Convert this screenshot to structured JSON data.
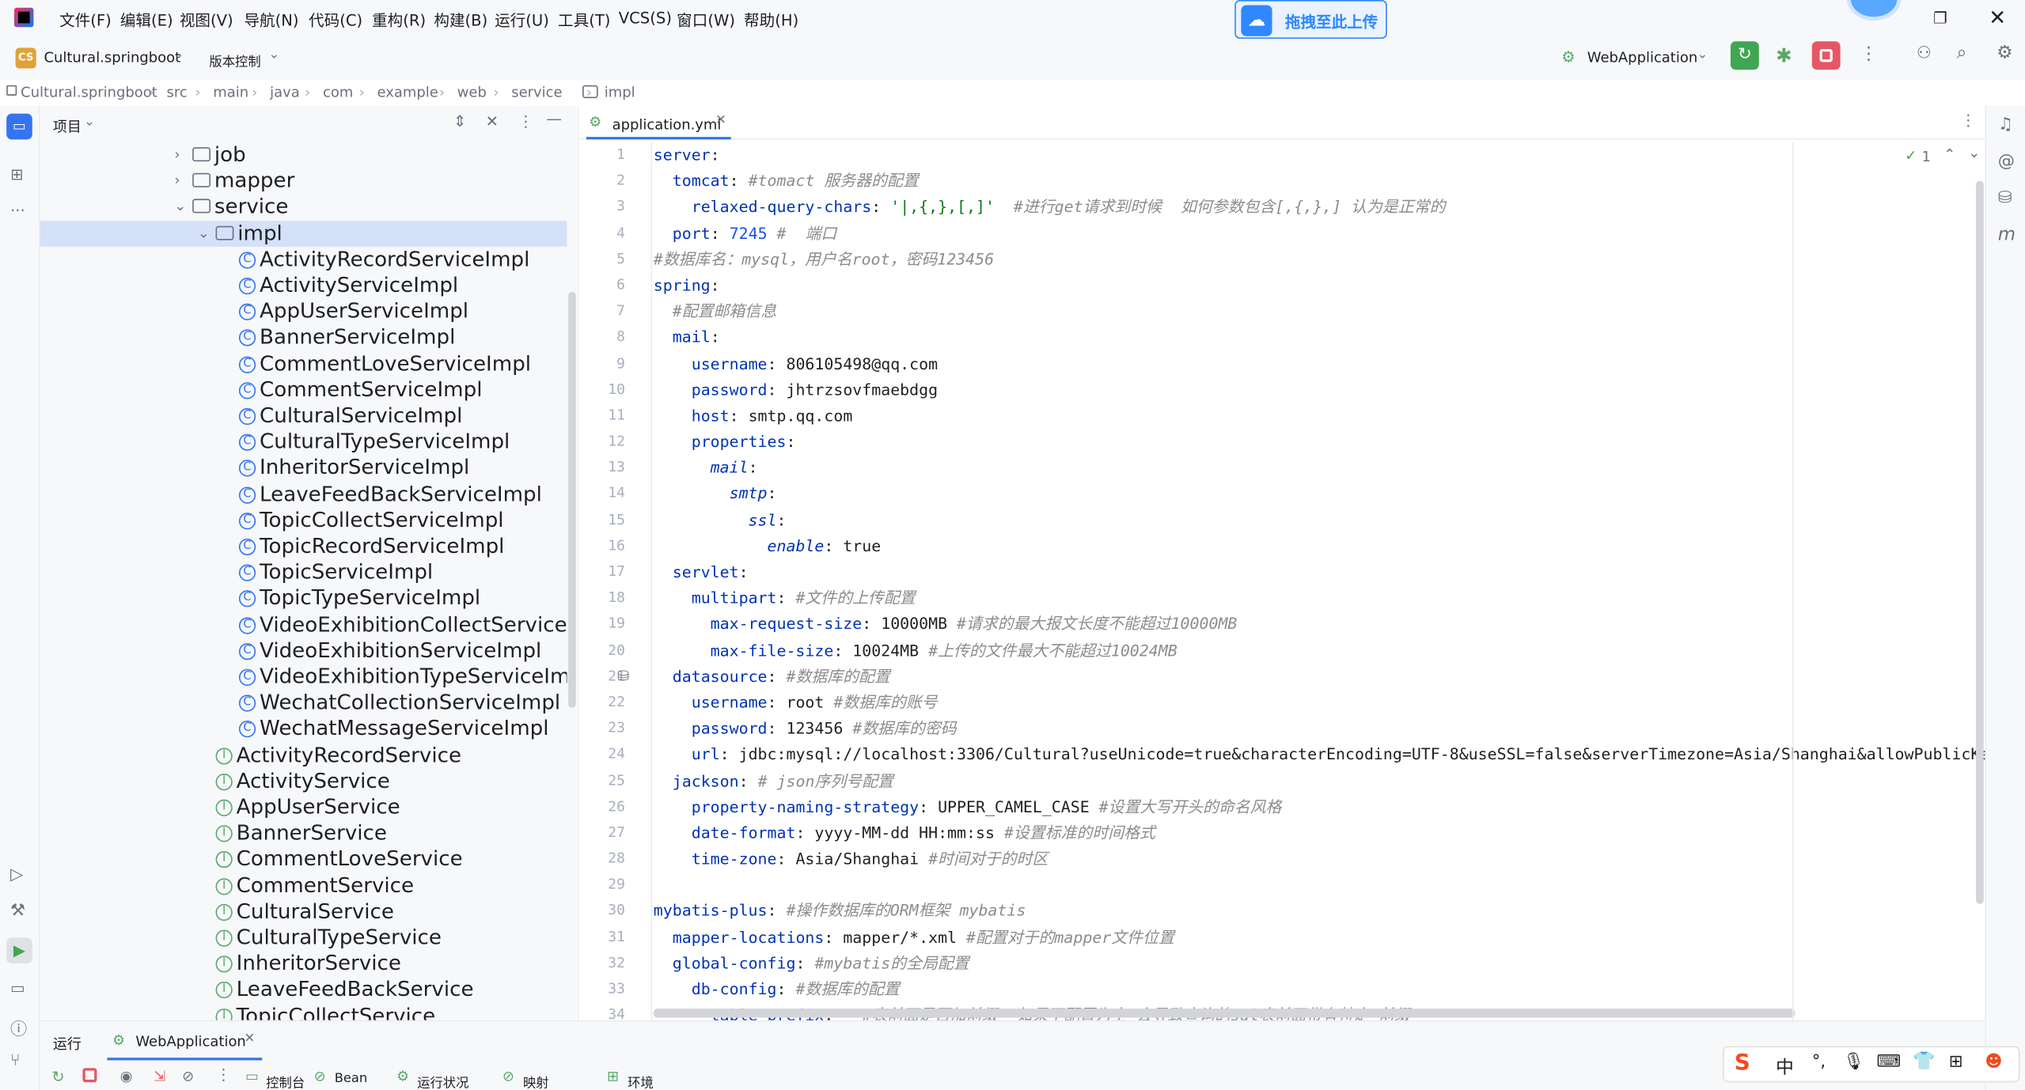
{
  "menu": [
    "文件(F)",
    "编辑(E)",
    "视图(V)",
    "导航(N)",
    "代码(C)",
    "重构(R)",
    "构建(B)",
    "运行(U)",
    "工具(T)",
    "VCS(S)",
    "窗口(W)",
    "帮助(H)"
  ],
  "project_name": "Cultural.springboot",
  "project_badge": "CS",
  "vcs_label": "版本控制",
  "upload_label": "拖拽至此上传",
  "run_config": "WebApplication",
  "breadcrumb": [
    "Cultural.springboot",
    "src",
    "main",
    "java",
    "com",
    "example",
    "web",
    "service",
    "impl"
  ],
  "panel_title": "项目",
  "tree": {
    "folders": [
      "job",
      "mapper",
      "service",
      "impl"
    ],
    "impl_classes": [
      "ActivityRecordServiceImpl",
      "ActivityServiceImpl",
      "AppUserServiceImpl",
      "BannerServiceImpl",
      "CommentLoveServiceImpl",
      "CommentServiceImpl",
      "CulturalServiceImpl",
      "CulturalTypeServiceImpl",
      "InheritorServiceImpl",
      "LeaveFeedBackServiceImpl",
      "TopicCollectServiceImpl",
      "TopicRecordServiceImpl",
      "TopicServiceImpl",
      "TopicTypeServiceImpl",
      "VideoExhibitionCollectServiceImpl",
      "VideoExhibitionServiceImpl",
      "VideoExhibitionTypeServiceImpl",
      "WechatCollectionServiceImpl",
      "WechatMessageServiceImpl"
    ],
    "interfaces": [
      "ActivityRecordService",
      "ActivityService",
      "AppUserService",
      "BannerService",
      "CommentLoveService",
      "CommentService",
      "CulturalService",
      "CulturalTypeService",
      "InheritorService",
      "LeaveFeedBackService",
      "TopicCollectService"
    ]
  },
  "tab": "application.yml",
  "inspections": "1",
  "code_lines": [
    [
      [
        "k",
        "server"
      ],
      [
        "v",
        ":"
      ]
    ],
    [
      [
        "v",
        "  "
      ],
      [
        "k",
        "tomcat"
      ],
      [
        "v",
        ": "
      ],
      [
        "c",
        "#tomact 服务器的配置"
      ]
    ],
    [
      [
        "v",
        "    "
      ],
      [
        "k",
        "relaxed-query-chars"
      ],
      [
        "v",
        ": "
      ],
      [
        "s",
        "'|,{,},[,]'"
      ],
      [
        "v",
        "  "
      ],
      [
        "c",
        "#进行get请求到时候  如何参数包含[,{,},] 认为是正常的"
      ]
    ],
    [
      [
        "v",
        "  "
      ],
      [
        "k",
        "port"
      ],
      [
        "v",
        ": "
      ],
      [
        "n",
        "7245"
      ],
      [
        "v",
        " "
      ],
      [
        "c",
        "#  端口"
      ]
    ],
    [
      [
        "c",
        "#数据库名：mysql，用户名root，密码123456"
      ]
    ],
    [
      [
        "k",
        "spring"
      ],
      [
        "v",
        ":"
      ]
    ],
    [
      [
        "v",
        "  "
      ],
      [
        "c",
        "#配置邮箱信息"
      ]
    ],
    [
      [
        "v",
        "  "
      ],
      [
        "k",
        "mail"
      ],
      [
        "v",
        ":"
      ]
    ],
    [
      [
        "v",
        "    "
      ],
      [
        "k",
        "username"
      ],
      [
        "v",
        ": 806105498@qq.com"
      ]
    ],
    [
      [
        "v",
        "    "
      ],
      [
        "k",
        "password"
      ],
      [
        "v",
        ": jhtrzsovfmaebdgg"
      ]
    ],
    [
      [
        "v",
        "    "
      ],
      [
        "k",
        "host"
      ],
      [
        "v",
        ": smtp.qq.com"
      ]
    ],
    [
      [
        "v",
        "    "
      ],
      [
        "k",
        "properties"
      ],
      [
        "v",
        ":"
      ]
    ],
    [
      [
        "v",
        "      "
      ],
      [
        "ki",
        "mail"
      ],
      [
        "v",
        ":"
      ]
    ],
    [
      [
        "v",
        "        "
      ],
      [
        "ki",
        "smtp"
      ],
      [
        "v",
        ":"
      ]
    ],
    [
      [
        "v",
        "          "
      ],
      [
        "ki",
        "ssl"
      ],
      [
        "v",
        ":"
      ]
    ],
    [
      [
        "v",
        "            "
      ],
      [
        "ki",
        "enable"
      ],
      [
        "v",
        ": true"
      ]
    ],
    [
      [
        "v",
        "  "
      ],
      [
        "k",
        "servlet"
      ],
      [
        "v",
        ":"
      ]
    ],
    [
      [
        "v",
        "    "
      ],
      [
        "k",
        "multipart"
      ],
      [
        "v",
        ": "
      ],
      [
        "c",
        "#文件的上传配置"
      ]
    ],
    [
      [
        "v",
        "      "
      ],
      [
        "k",
        "max-request-size"
      ],
      [
        "v",
        ": 10000MB "
      ],
      [
        "c",
        "#请求的最大报文长度不能超过10000MB"
      ]
    ],
    [
      [
        "v",
        "      "
      ],
      [
        "k",
        "max-file-size"
      ],
      [
        "v",
        ": 10024MB "
      ],
      [
        "c",
        "#上传的文件最大不能超过10024MB"
      ]
    ],
    [
      [
        "v",
        "  "
      ],
      [
        "k",
        "datasource"
      ],
      [
        "v",
        ": "
      ],
      [
        "c",
        "#数据库的配置"
      ]
    ],
    [
      [
        "v",
        "    "
      ],
      [
        "k",
        "username"
      ],
      [
        "v",
        ": root "
      ],
      [
        "c",
        "#数据库的账号"
      ]
    ],
    [
      [
        "v",
        "    "
      ],
      [
        "k",
        "password"
      ],
      [
        "v",
        ": 123456 "
      ],
      [
        "c",
        "#数据库的密码"
      ]
    ],
    [
      [
        "v",
        "    "
      ],
      [
        "k",
        "url"
      ],
      [
        "v",
        ": jdbc:mysql://localhost:3306/Cultural?useUnicode=true&characterEncoding=UTF-8&useSSL=false&serverTimezone=Asia/Shanghai&allowPublicKe"
      ]
    ],
    [
      [
        "v",
        "  "
      ],
      [
        "k",
        "jackson"
      ],
      [
        "v",
        ": "
      ],
      [
        "c",
        "# json序列号配置"
      ]
    ],
    [
      [
        "v",
        "    "
      ],
      [
        "k",
        "property-naming-strategy"
      ],
      [
        "v",
        ": UPPER_CAMEL_CASE "
      ],
      [
        "c",
        "#设置大写开头的命名风格"
      ]
    ],
    [
      [
        "v",
        "    "
      ],
      [
        "k",
        "date-format"
      ],
      [
        "v",
        ": yyyy-MM-dd HH:mm:ss "
      ],
      [
        "c",
        "#设置标准的时间格式"
      ]
    ],
    [
      [
        "v",
        "    "
      ],
      [
        "k",
        "time-zone"
      ],
      [
        "v",
        ": Asia/Shanghai "
      ],
      [
        "c",
        "#时间对于的时区"
      ]
    ],
    [
      [
        "v",
        ""
      ]
    ],
    [
      [
        "k",
        "mybatis-plus"
      ],
      [
        "v",
        ": "
      ],
      [
        "c",
        "#操作数据库的ORM框架 mybatis"
      ]
    ],
    [
      [
        "v",
        "  "
      ],
      [
        "k",
        "mapper-locations"
      ],
      [
        "v",
        ": mapper/*.xml "
      ],
      [
        "c",
        "#配置对于的mapper文件位置"
      ]
    ],
    [
      [
        "v",
        "  "
      ],
      [
        "k",
        "global-config"
      ],
      [
        "v",
        ": "
      ],
      [
        "c",
        "#mybatis的全局配置"
      ]
    ],
    [
      [
        "v",
        "    "
      ],
      [
        "k",
        "db-config"
      ],
      [
        "v",
        ": "
      ],
      [
        "c",
        "#数据库的配置"
      ]
    ],
    [
      [
        "v",
        "      "
      ],
      [
        "k",
        "table-prefix"
      ],
      [
        "v",
        ":   "
      ],
      [
        "c",
        "#表前面是否加前缀  如果不配置为空 会导致查询的sql表前面带有特定 前缀"
      ]
    ]
  ],
  "bottom": {
    "run_label": "运行",
    "run_tab": "WebApplication",
    "tabs": [
      "控制台",
      "Bean",
      "运行状况",
      "映射",
      "环境"
    ]
  },
  "ime": {
    "lang": "中"
  }
}
